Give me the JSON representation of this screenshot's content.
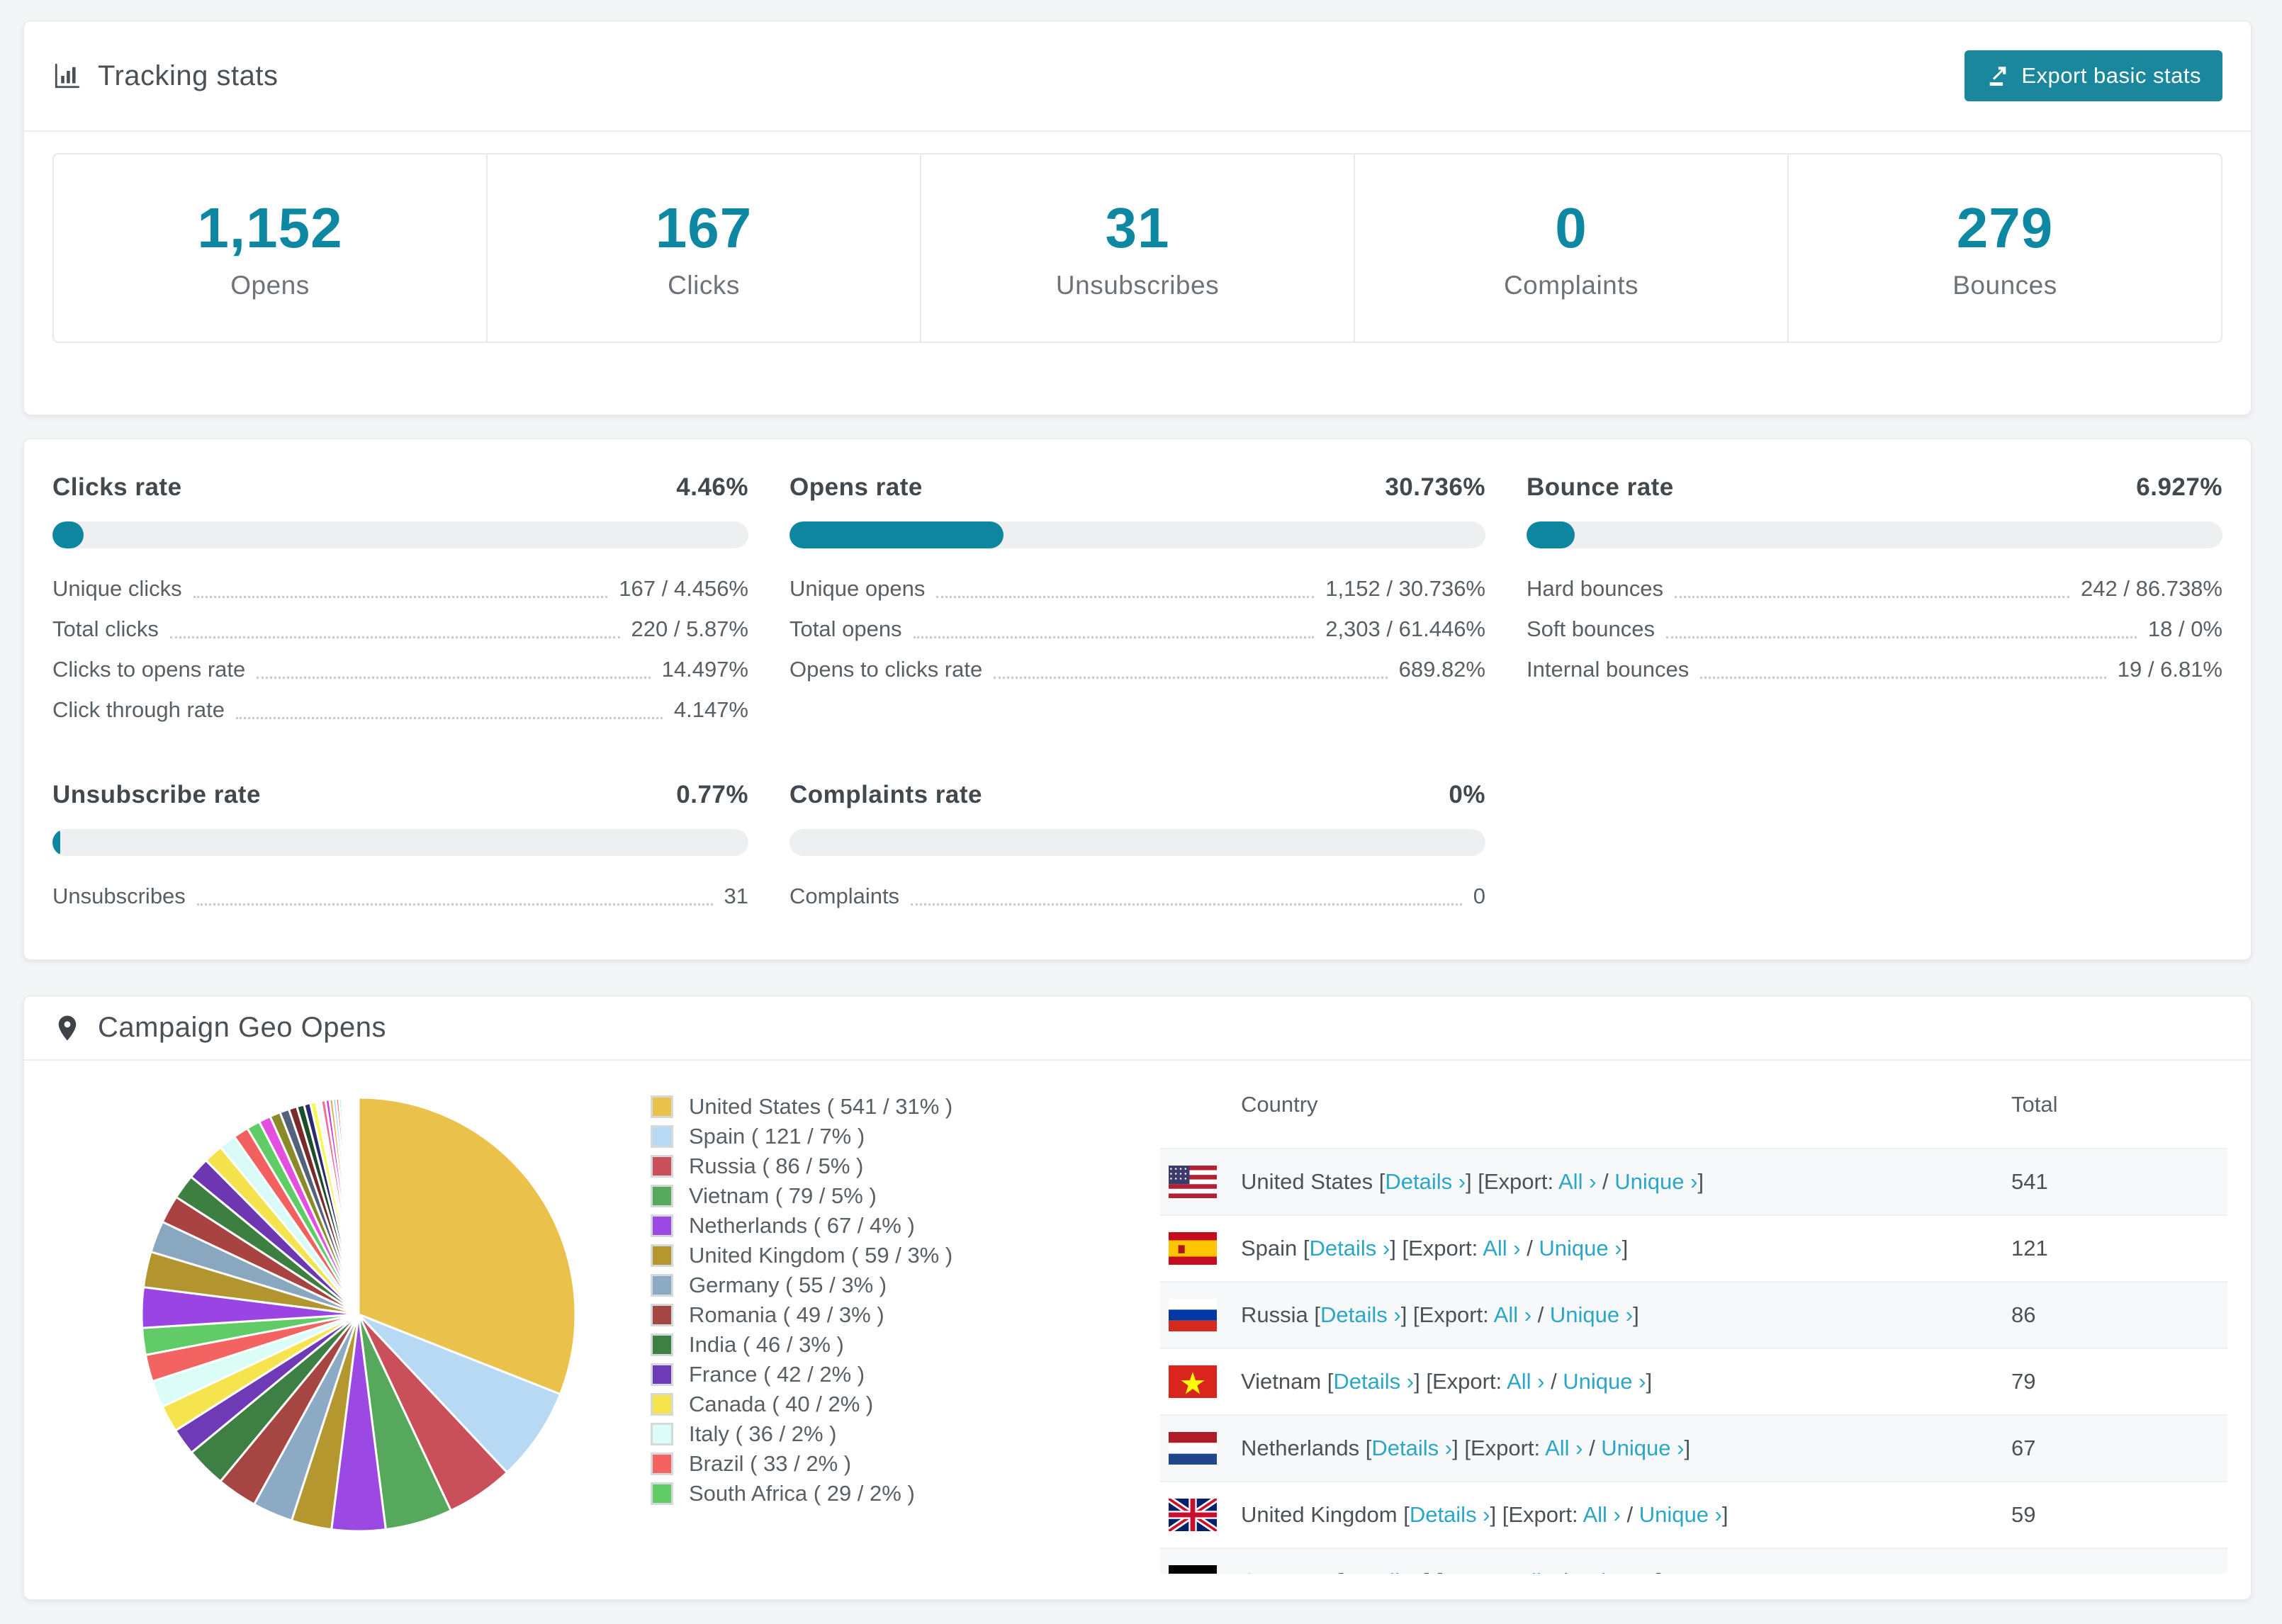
{
  "colors": {
    "accent": "#0e87a2",
    "button": "#1b879c",
    "link": "#2ba6c9",
    "bar_track": "#edeff1",
    "row_stripe": "#f7f8f9"
  },
  "tracking": {
    "title": "Tracking stats",
    "export_label": "Export basic stats",
    "stats": [
      {
        "value": "1,152",
        "label": "Opens"
      },
      {
        "value": "167",
        "label": "Clicks"
      },
      {
        "value": "31",
        "label": "Unsubscribes"
      },
      {
        "value": "0",
        "label": "Complaints"
      },
      {
        "value": "279",
        "label": "Bounces"
      }
    ]
  },
  "rates": {
    "sections": [
      {
        "title": "Clicks rate",
        "pct_label": "4.46%",
        "pct": 4.46,
        "rows": [
          {
            "label": "Unique clicks",
            "value": "167 / 4.456%"
          },
          {
            "label": "Total clicks",
            "value": "220 / 5.87%"
          },
          {
            "label": "Clicks to opens rate",
            "value": "14.497%"
          },
          {
            "label": "Click through rate",
            "value": "4.147%"
          }
        ]
      },
      {
        "title": "Opens rate",
        "pct_label": "30.736%",
        "pct": 30.736,
        "rows": [
          {
            "label": "Unique opens",
            "value": "1,152 / 30.736%"
          },
          {
            "label": "Total opens",
            "value": "2,303 / 61.446%"
          },
          {
            "label": "Opens to clicks rate",
            "value": "689.82%"
          }
        ]
      },
      {
        "title": "Bounce rate",
        "pct_label": "6.927%",
        "pct": 6.927,
        "rows": [
          {
            "label": "Hard bounces",
            "value": "242 / 86.738%"
          },
          {
            "label": "Soft bounces",
            "value": "18 / 0%"
          },
          {
            "label": "Internal bounces",
            "value": "19 / 6.81%"
          }
        ]
      },
      {
        "title": "Unsubscribe rate",
        "pct_label": "0.77%",
        "pct": 0.77,
        "rows": [
          {
            "label": "Unsubscribes",
            "value": "31"
          }
        ]
      },
      {
        "title": "Complaints rate",
        "pct_label": "0%",
        "pct": 0,
        "rows": [
          {
            "label": "Complaints",
            "value": "0"
          }
        ]
      }
    ]
  },
  "geo": {
    "title": "Campaign Geo Opens",
    "table": {
      "columns": [
        "Country",
        "Total"
      ],
      "link_labels": {
        "details": "Details ›",
        "export": "Export:",
        "all": "All ›",
        "unique": "Unique ›"
      },
      "rows": [
        {
          "country": "United States",
          "flag": "us",
          "total": "541"
        },
        {
          "country": "Spain",
          "flag": "es",
          "total": "121"
        },
        {
          "country": "Russia",
          "flag": "ru",
          "total": "86"
        },
        {
          "country": "Vietnam",
          "flag": "vn",
          "total": "79"
        },
        {
          "country": "Netherlands",
          "flag": "nl",
          "total": "67"
        },
        {
          "country": "United Kingdom",
          "flag": "gb",
          "total": "59"
        },
        {
          "country": "Germany",
          "flag": "de",
          "total": ""
        }
      ]
    }
  },
  "chart_data": {
    "type": "pie",
    "title": "Campaign Geo Opens",
    "legend_position": "right",
    "start_angle_deg": 0,
    "direction": "clockwise",
    "slices": [
      {
        "label": "United States",
        "value": 541,
        "pct": 31,
        "color": "#e9c14b"
      },
      {
        "label": "Spain",
        "value": 121,
        "pct": 7,
        "color": "#b7d9f4"
      },
      {
        "label": "Russia",
        "value": 86,
        "pct": 5,
        "color": "#c9505a"
      },
      {
        "label": "Vietnam",
        "value": 79,
        "pct": 5,
        "color": "#55a85c"
      },
      {
        "label": "Netherlands",
        "value": 67,
        "pct": 4,
        "color": "#9b49e2"
      },
      {
        "label": "United Kingdom",
        "value": 59,
        "pct": 3,
        "color": "#b5972f"
      },
      {
        "label": "Germany",
        "value": 55,
        "pct": 3,
        "color": "#8caac3"
      },
      {
        "label": "Romania",
        "value": 49,
        "pct": 3,
        "color": "#a64643"
      },
      {
        "label": "India",
        "value": 46,
        "pct": 3,
        "color": "#3e8044"
      },
      {
        "label": "France",
        "value": 42,
        "pct": 2,
        "color": "#6f3ab5"
      },
      {
        "label": "Canada",
        "value": 40,
        "pct": 2,
        "color": "#f6e44e"
      },
      {
        "label": "Italy",
        "value": 36,
        "pct": 2,
        "color": "#dcfcf7"
      },
      {
        "label": "Brazil",
        "value": 33,
        "pct": 2,
        "color": "#f26361"
      },
      {
        "label": "South Africa",
        "value": 29,
        "pct": 2,
        "color": "#61cb67"
      }
    ],
    "other_slices": {
      "total_pct": 26,
      "count": 44,
      "decay": 0.885,
      "palette": [
        "#9a45e3",
        "#b2952f",
        "#8aa7c0",
        "#a84341",
        "#3d7f41",
        "#6d37b2",
        "#f5e34e",
        "#d8fbf8",
        "#f2615f",
        "#5fcc66",
        "#e44fe0",
        "#8a8a2a",
        "#53627a",
        "#7a2a2a",
        "#1e4d2b",
        "#2a2a6e",
        "#f7f74e",
        "#fafafa",
        "#f06a9a",
        "#c83ce0",
        "#e0a03c",
        "#a8c8f0",
        "#e03c3c",
        "#3ce05a",
        "#8a3ce0"
      ]
    }
  }
}
